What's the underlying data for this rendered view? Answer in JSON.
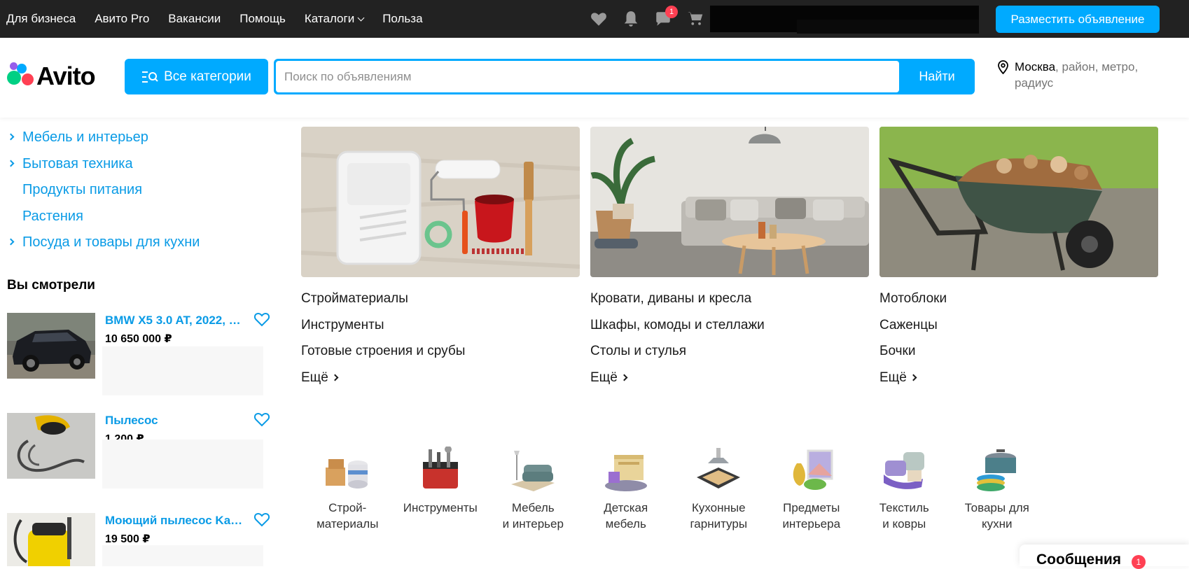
{
  "topnav": {
    "links": [
      "Для бизнеса",
      "Авито Pro",
      "Вакансии",
      "Помощь",
      "Каталоги",
      "Польза"
    ],
    "notif_count": "1",
    "post_button": "Разместить объявление"
  },
  "header": {
    "logo_text": "Avito",
    "categories_button": "Все категории",
    "search_placeholder": "Поиск по объявлениям",
    "search_button": "Найти",
    "location_city": "Москва",
    "location_rest": ", район, метро, радиус"
  },
  "sidebar": {
    "categories": [
      {
        "label": "Мебель и интерьер",
        "has_children": true
      },
      {
        "label": "Бытовая техника",
        "has_children": true
      },
      {
        "label": "Продукты питания",
        "has_children": false
      },
      {
        "label": "Растения",
        "has_children": false
      },
      {
        "label": "Посуда и товары для кухни",
        "has_children": true
      }
    ],
    "seen_title": "Вы смотрели",
    "seen_items": [
      {
        "title": "BMW X5 3.0 AT, 2022, …",
        "price": "10 650 000 ₽"
      },
      {
        "title": "Пылесос",
        "price": "1 200 ₽"
      },
      {
        "title": "Моющий пылесос Ka…",
        "price": "19 500 ₽"
      }
    ]
  },
  "main": {
    "columns": [
      {
        "links": [
          "Стройматериалы",
          "Инструменты",
          "Готовые строения и срубы"
        ],
        "more": "Ещё"
      },
      {
        "links": [
          "Кровати, диваны и кресла",
          "Шкафы, комоды и стеллажи",
          "Столы и стулья"
        ],
        "more": "Ещё"
      },
      {
        "links": [
          "Мотоблоки",
          "Саженцы",
          "Бочки"
        ],
        "more": "Ещё"
      }
    ],
    "icon_categories": [
      {
        "label": "Строй-\nматериалы",
        "icon": "building-materials-icon"
      },
      {
        "label": "Инструменты",
        "icon": "tools-icon"
      },
      {
        "label": "Мебель\nи интерьер",
        "icon": "furniture-icon"
      },
      {
        "label": "Детская\nмебель",
        "icon": "kids-furniture-icon"
      },
      {
        "label": "Кухонные\nгарнитуры",
        "icon": "kitchen-icon"
      },
      {
        "label": "Предметы\nинтерьера",
        "icon": "decor-icon"
      },
      {
        "label": "Текстиль\nи ковры",
        "icon": "textile-icon"
      },
      {
        "label": "Товары для\nкухни",
        "icon": "cookware-icon"
      }
    ]
  },
  "messages": {
    "label": "Сообщения",
    "count": "1"
  },
  "colors": {
    "accent": "#00aaff",
    "link": "#0a9be6",
    "topbar": "#222222",
    "badge": "#ff4053"
  }
}
